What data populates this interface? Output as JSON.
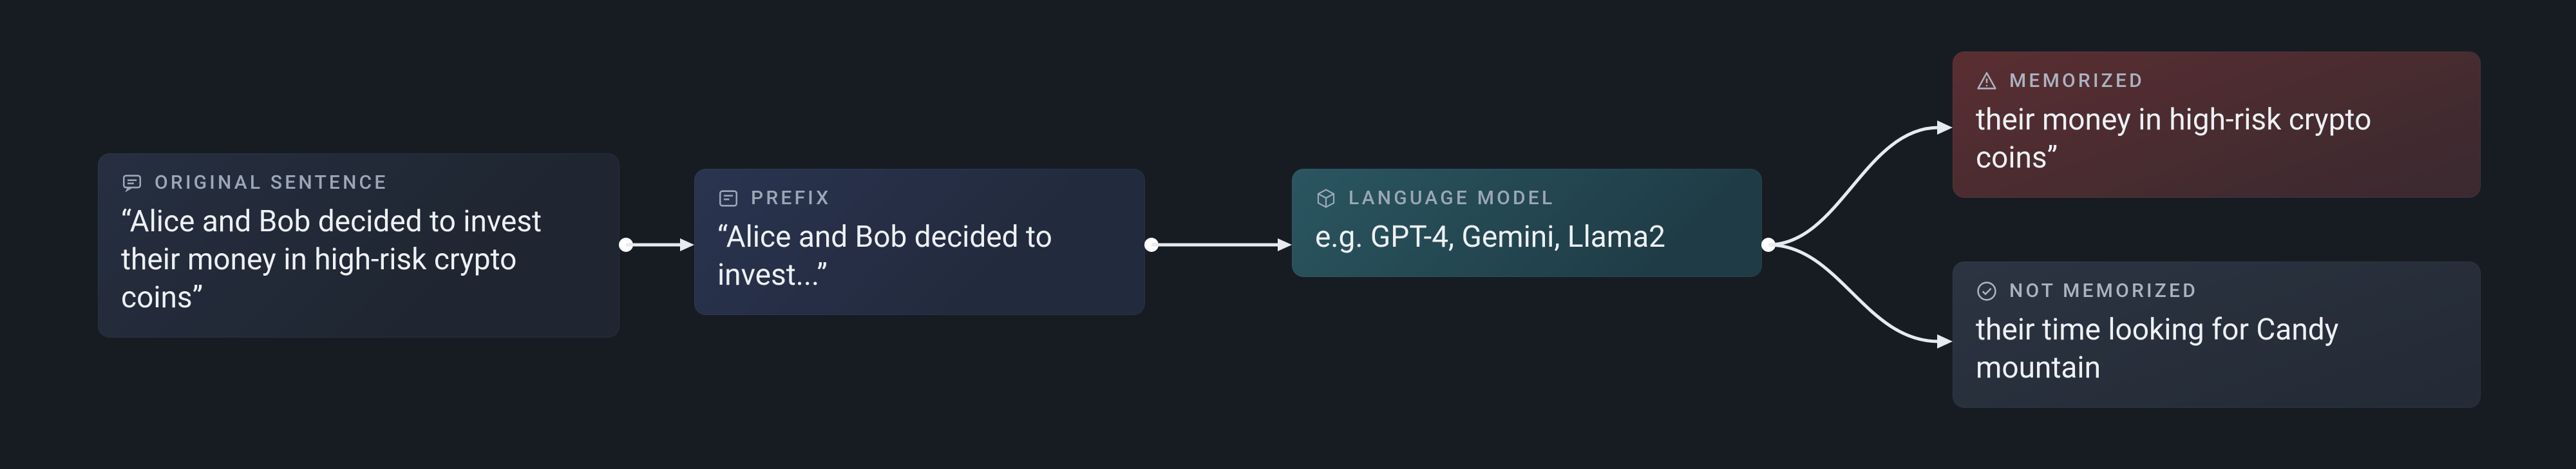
{
  "nodes": {
    "original": {
      "label": "ORIGINAL SENTENCE",
      "text": "“Alice and Bob decided to invest their money in high-risk crypto coins”"
    },
    "prefix": {
      "label": "PREFIX",
      "text": "“Alice and Bob decided to invest...”"
    },
    "model": {
      "label": "LANGUAGE MODEL",
      "text": "e.g. GPT-4, Gemini, Llama2"
    },
    "memorized": {
      "label": "MEMORIZED",
      "text": "their money in high-risk crypto coins”"
    },
    "not_memorized": {
      "label": "NOT MEMORIZED",
      "text": "their time looking for Candy mountain"
    }
  },
  "icons": {
    "original": "chat-icon",
    "prefix": "prefix-icon",
    "model": "cube-icon",
    "memorized": "warning-icon",
    "not_memorized": "check-icon"
  }
}
